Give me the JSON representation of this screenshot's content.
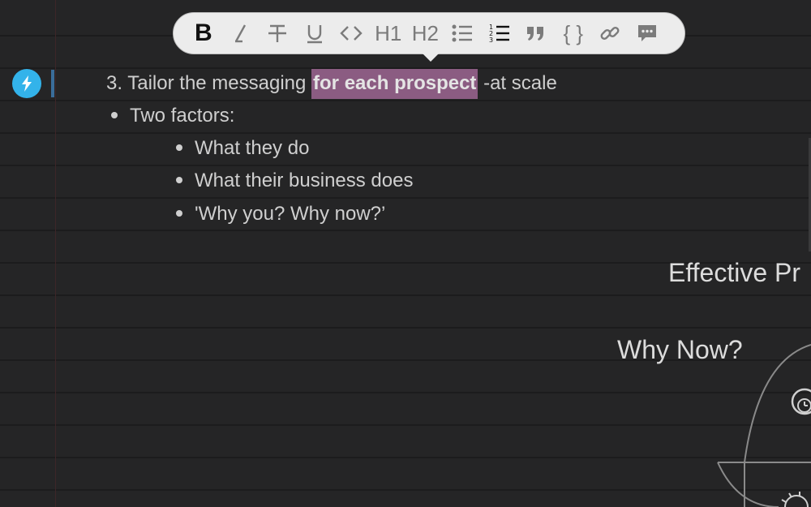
{
  "toolbar": {
    "bold": "B",
    "h1": "H1",
    "h2": "H2",
    "code_block": "{ }",
    "quote": "”"
  },
  "doc": {
    "line1_prefix": "3. Tailor the messaging ",
    "line1_highlight": "for each prospect",
    "line1_suffix": " -at scale",
    "bullet1": "Two factors:",
    "sub_bullets": [
      "What they do",
      "What their business does",
      "'Why you? Why now?’"
    ]
  },
  "slide": {
    "title": "Effective Pr",
    "subtitle": "Why Now?"
  },
  "colors": {
    "background": "#252526",
    "highlight": "#8b5c82",
    "accent": "#33b3ea",
    "toolbar": "#ececec"
  },
  "icons": {
    "action": "lightning-icon",
    "toolbar": [
      "bold-icon",
      "italic-icon",
      "strikethrough-icon",
      "underline-icon",
      "inline-code-icon",
      "heading1-icon",
      "heading2-icon",
      "bullet-list-icon",
      "numbered-list-icon",
      "quote-icon",
      "code-block-icon",
      "link-icon",
      "comment-icon"
    ]
  }
}
